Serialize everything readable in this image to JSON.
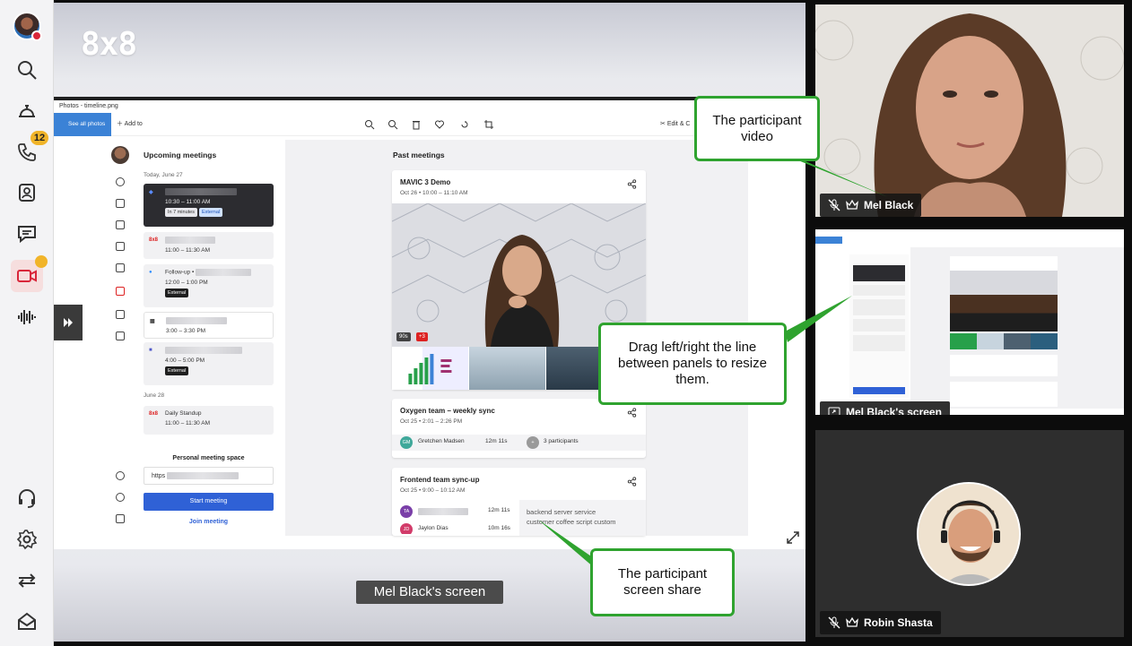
{
  "brand": {
    "logo_text": "8x8"
  },
  "rail": {
    "items": [
      {
        "name": "Search",
        "icon": "search-icon"
      },
      {
        "name": "Reception",
        "icon": "service-bell-icon"
      },
      {
        "name": "Calls",
        "icon": "phone-icon",
        "badge": "12"
      },
      {
        "name": "Contacts",
        "icon": "contacts-icon"
      },
      {
        "name": "Chat",
        "icon": "chat-icon"
      },
      {
        "name": "Meetings",
        "icon": "video-icon",
        "active": true
      },
      {
        "name": "Voice",
        "icon": "waveform-icon"
      },
      {
        "name": "Support",
        "icon": "headset-icon"
      },
      {
        "name": "Settings",
        "icon": "gear-icon"
      },
      {
        "name": "Switch",
        "icon": "swap-arrows-icon"
      },
      {
        "name": "Inbox",
        "icon": "inbox-icon"
      }
    ],
    "calls_badge": "12",
    "accent_color": "#d9263a"
  },
  "stage": {
    "shared_label": "Mel Black's screen",
    "viewer": {
      "titlebar": "Photos - timeline.png",
      "see_all": "See all photos",
      "add_to": "Add to",
      "edit": "Edit & C"
    },
    "app": {
      "upcoming_title": "Upcoming meetings",
      "today_label": "Today, June 27",
      "june28_label": "June 28",
      "meetings": [
        {
          "time": "10:30 – 11:00 AM",
          "tags": [
            "In 7 minutes",
            "External"
          ]
        },
        {
          "logo": "8x8",
          "time": "11:00 – 11:30 AM"
        },
        {
          "title": "Follow-up •",
          "time": "12:00 – 1:00 PM",
          "tags": [
            "External"
          ]
        },
        {
          "time": "3:00 – 3:30 PM"
        },
        {
          "time": "4:00 – 5:00 PM",
          "tags": [
            "External"
          ]
        },
        {
          "logo": "8x8",
          "title": "Daily Standup",
          "time": "11:00 – 11:30 AM"
        }
      ],
      "pms_title": "Personal meeting space",
      "pms_url": "https",
      "start_meeting": "Start meeting",
      "join_meeting": "Join meeting",
      "past_title": "Past meetings",
      "past": [
        {
          "title": "MAVIC 3 Demo",
          "date": "Oct 26",
          "time": "10:00 – 11:10 AM",
          "badge_time": "90s",
          "badge_more": "+3"
        },
        {
          "title": "Oxygen team – weekly sync",
          "date": "Oct 25",
          "time": "2:01 – 2:26 PM",
          "person": "Gretchen Madsen",
          "person_initials": "GM",
          "duration": "12m 11s",
          "participants": "3 participants"
        },
        {
          "title": "Frontend team sync-up",
          "date": "Oct 25",
          "time": "9:00 – 10:12 AM",
          "person1_initials": "TA",
          "person1_duration": "12m 11s",
          "person2": "Jaylon Dias",
          "person2_initials": "JD",
          "person2_duration": "10m 16s",
          "keywords": "backend  server  service\ncustomer  coffee  script  custom"
        }
      ]
    }
  },
  "participants": [
    {
      "name": "Mel Black",
      "muted": true,
      "host": true,
      "tile": "video"
    },
    {
      "name": "Mel Black's screen",
      "tile": "screen"
    },
    {
      "name": "Robin Shasta",
      "muted": true,
      "host": true,
      "tile": "avatar"
    }
  ],
  "callouts": {
    "video": "The participant video",
    "resize": "Drag left/right the line between panels to resize them.",
    "share": "The participant screen share"
  },
  "colors": {
    "callout_border": "#2fa32f",
    "badge": "#f1b429",
    "primary": "#2f61d6"
  }
}
